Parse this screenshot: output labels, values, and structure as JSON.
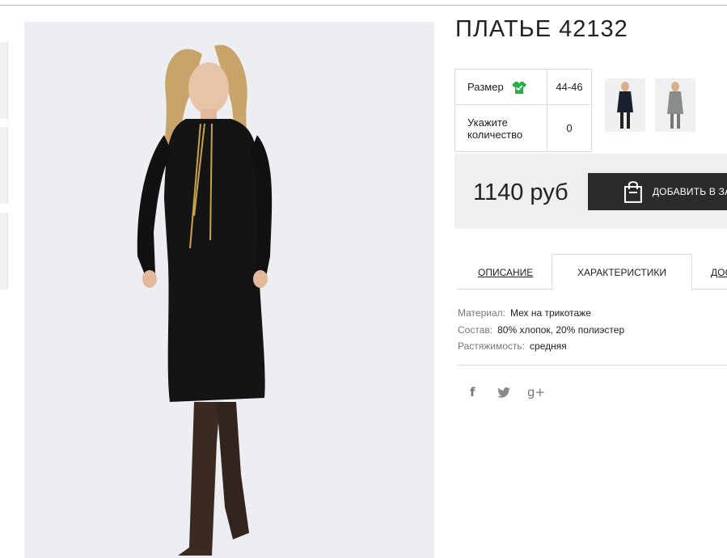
{
  "product": {
    "title": "ПЛАТЬЕ 42132"
  },
  "params": {
    "size_label": "Размер",
    "size_value": "44-46",
    "qty_label": "Укажите количество",
    "qty_value": "0"
  },
  "price": {
    "amount": "1140 руб"
  },
  "cart": {
    "add_label": "ДОБАВИТЬ В ЗАКАЗ"
  },
  "tabs": [
    {
      "label": "ОПИСАНИЕ",
      "active": false
    },
    {
      "label": "ХАРАКТЕРИСТИКИ",
      "active": true
    },
    {
      "label": "ДОС",
      "active": false
    }
  ],
  "specs": [
    {
      "key": "Материал:",
      "value": "Мех на трикотаже"
    },
    {
      "key": "Состав:",
      "value": "80% хлопок, 20% полиэстер"
    },
    {
      "key": "Растяжимость:",
      "value": "средняя"
    }
  ],
  "social": [
    {
      "icon": "facebook-icon",
      "glyph": "f"
    },
    {
      "icon": "twitter-icon",
      "glyph": "t"
    },
    {
      "icon": "google-plus-icon",
      "glyph": "g+"
    }
  ],
  "colors": {
    "accent_green": "#27b04a",
    "button_dark": "#2b2b2b",
    "price_bg": "#efefef"
  }
}
